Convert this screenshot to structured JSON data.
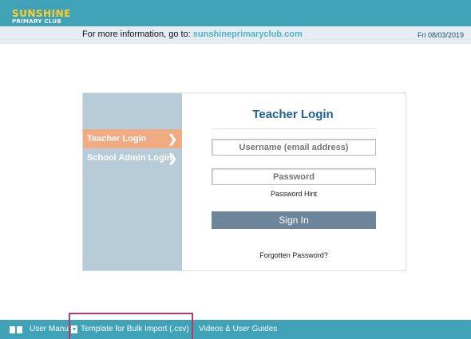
{
  "header": {
    "logo_main": "SUNSHINE",
    "logo_sub": "PRIMARY CLUB",
    "info_prefix": "For more information, go to:",
    "info_link": "sunshineprimaryclub.com",
    "date": "Fri 08/03/2019"
  },
  "login": {
    "title": "Teacher Login",
    "nav": [
      {
        "label": "Teacher Login",
        "icon": "chevron-right-icon",
        "active": true
      },
      {
        "label": "School Admin Login",
        "icon": "chevron-right-icon",
        "active": false
      }
    ],
    "username_placeholder": "Username (email address)",
    "password_placeholder": "Password",
    "password_hint": "Password Hint",
    "signin_label": "Sign In",
    "forgotten_password": "Forgotten Password?"
  },
  "footer": {
    "items": [
      {
        "label": "User Manu",
        "icon": "book-icon"
      },
      {
        "label": "Template for Bulk Import (.csv)",
        "icon": "download-icon"
      },
      {
        "label": "Videos & User Guides"
      }
    ]
  },
  "colors": {
    "header_teal": "#3fa2b7",
    "logo_yellow": "#ffcf2e",
    "title_blue": "#1f6194",
    "active_nav": "#f1ab82",
    "sidebar": "#b7cbd9",
    "signin_button": "#6e869c",
    "highlight": "#b33a6b"
  }
}
